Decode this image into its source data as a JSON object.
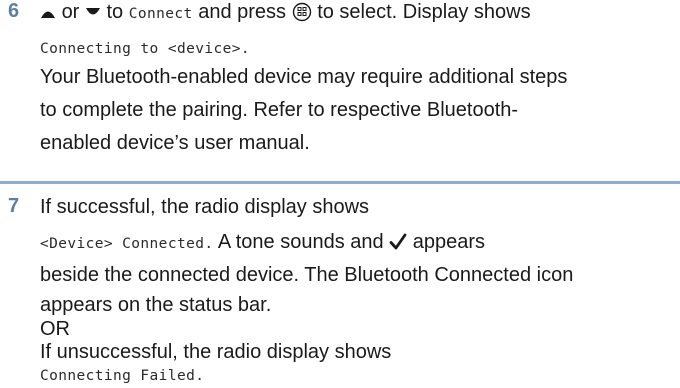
{
  "step6": {
    "number": "6",
    "line1": {
      "or": "or",
      "to": "to",
      "connect": "Connect",
      "and_press": "and press",
      "to_select": "to select. Display shows"
    },
    "line2": "Connecting to <device>.",
    "line3": "Your Bluetooth-enabled device may require additional steps",
    "line4": "to complete the pairing. Refer to respective Bluetooth-",
    "line5": "enabled device’s user manual."
  },
  "step7": {
    "number": "7",
    "line1": "If successful, the radio display shows",
    "line2": {
      "device_connected": "<Device> Connected.",
      "tone_sounds": "A tone sounds and",
      "appears": "appears"
    },
    "line3": "beside the connected device. The Bluetooth Connected icon",
    "line4": "appears on the status bar.",
    "line5": "OR",
    "line6": "If unsuccessful, the radio display shows",
    "line7": "Connecting Failed."
  },
  "colors": {
    "step_number": "#5b7fa6",
    "divider": "#8faecb"
  },
  "icons": {
    "up": "up-arrow-icon",
    "down": "down-arrow-icon",
    "ok": "menu-ok-button-icon",
    "check": "checkmark-icon"
  }
}
